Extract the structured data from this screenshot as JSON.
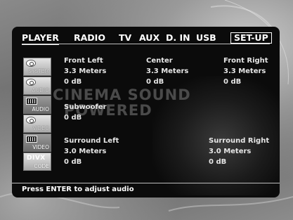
{
  "tabs": [
    {
      "label": "PLAYER"
    },
    {
      "label": "RADIO"
    },
    {
      "label": "TV"
    },
    {
      "label": "AUX"
    },
    {
      "label": "D. IN"
    },
    {
      "label": "USB"
    },
    {
      "label": "SET-UP"
    }
  ],
  "active_tab": "PLAYER",
  "side_menu": [
    {
      "label": "SYSTEM",
      "icon": "disc-icon"
    },
    {
      "label": "AUDIO",
      "icon": "disc-icon"
    },
    {
      "label": "AUDIO",
      "icon": "audio-bars-icon"
    },
    {
      "label": "VIDEO",
      "icon": "disc-icon"
    },
    {
      "label": "VIDEO",
      "icon": "video-bars-icon"
    },
    {
      "label": "CODE",
      "icon": "divx-icon",
      "badge": "DIVX"
    }
  ],
  "watermark": {
    "line1": "CINEMA SOUND",
    "line2": "POWERED"
  },
  "speakers": {
    "front_left": {
      "name": "Front Left",
      "distance": "3.3 Meters",
      "level": "0 dB"
    },
    "center": {
      "name": "Center",
      "distance": "3.3 Meters",
      "level": "0 dB"
    },
    "front_right": {
      "name": "Front Right",
      "distance": "3.3 Meters",
      "level": "0 dB"
    },
    "subwoofer": {
      "name": "Subwoofer",
      "level": "0 dB"
    },
    "surround_left": {
      "name": "Surround Left",
      "distance": "3.0 Meters",
      "level": "0 dB"
    },
    "surround_right": {
      "name": "Surround Right",
      "distance": "3.0 Meters",
      "level": "0 dB"
    }
  },
  "status": "Press ENTER to adjust audio",
  "colors": {
    "panel": "#0b0b0b",
    "text": "#ffffff",
    "accent": "#bdbdbd"
  }
}
